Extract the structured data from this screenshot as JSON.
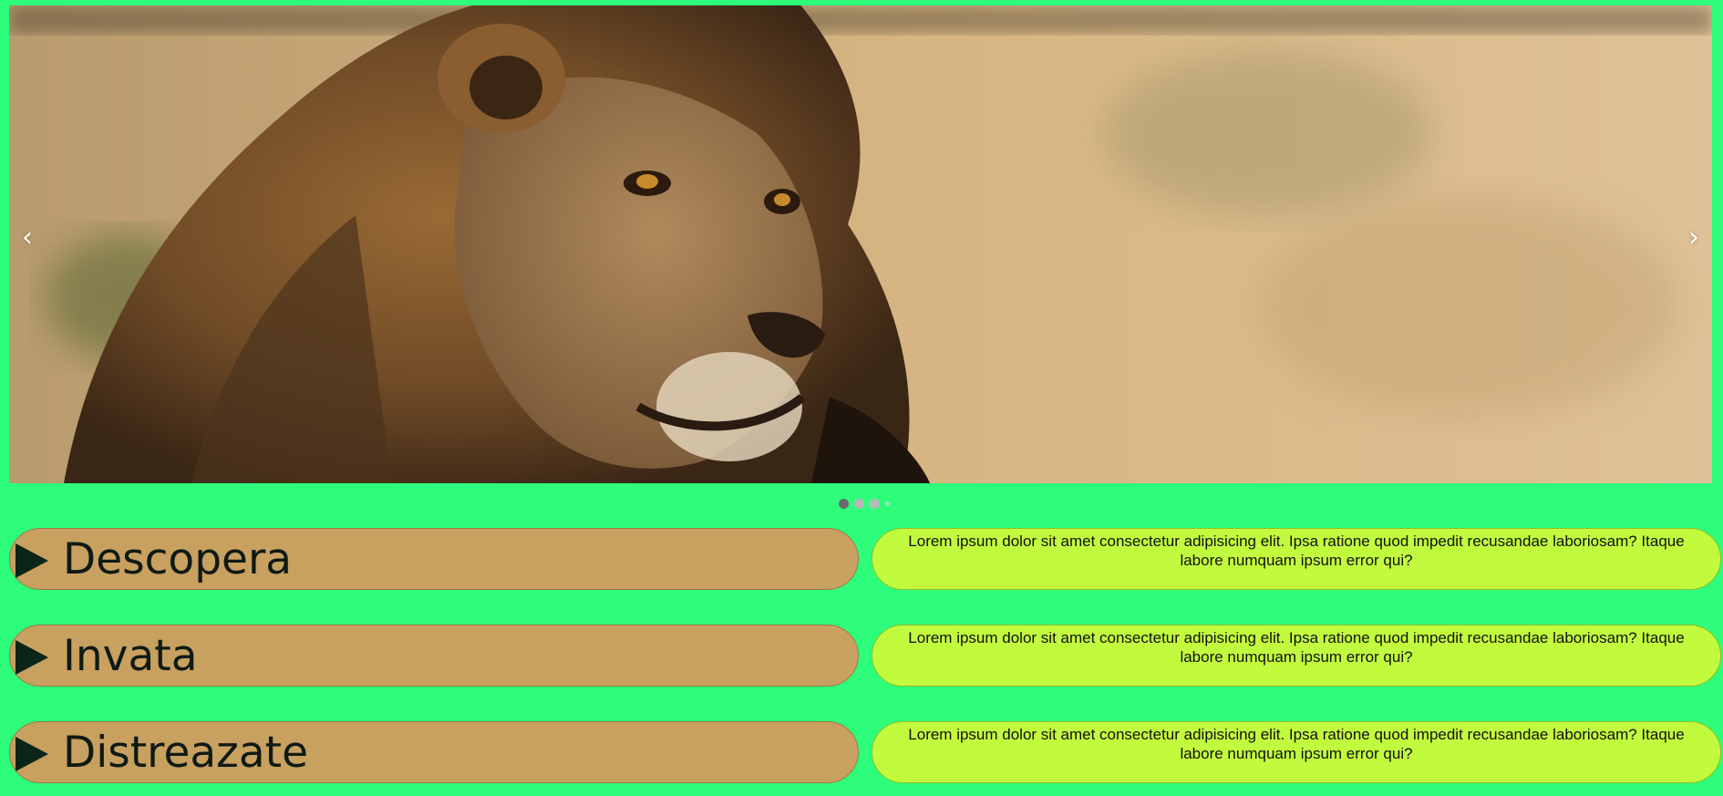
{
  "carousel": {
    "prev_glyph": "‹",
    "next_glyph": "›",
    "slide_count": 3,
    "active_slide": 1
  },
  "features": [
    {
      "title": "Descopera",
      "text": "Lorem ipsum dolor sit amet consectetur adipisicing elit. Ipsa ratione quod impedit recusandae laboriosam? Itaque labore numquam ipsum error qui?"
    },
    {
      "title": "Invata",
      "text": "Lorem ipsum dolor sit amet consectetur adipisicing elit. Ipsa ratione quod impedit recusandae laboriosam? Itaque labore numquam ipsum error qui?"
    },
    {
      "title": "Distreazate",
      "text": "Lorem ipsum dolor sit amet consectetur adipisicing elit. Ipsa ratione quod impedit recusandae laboriosam? Itaque labore numquam ipsum error qui?"
    }
  ],
  "colors": {
    "page_background": "#2dfd7b",
    "title_pill": "#c8a060",
    "text_pill": "#c2fb3e",
    "play_icon": "#0b2618"
  },
  "icons": {
    "feature_marker": "play-icon",
    "carousel_prev": "chevron-left-icon",
    "carousel_next": "chevron-right-icon"
  }
}
